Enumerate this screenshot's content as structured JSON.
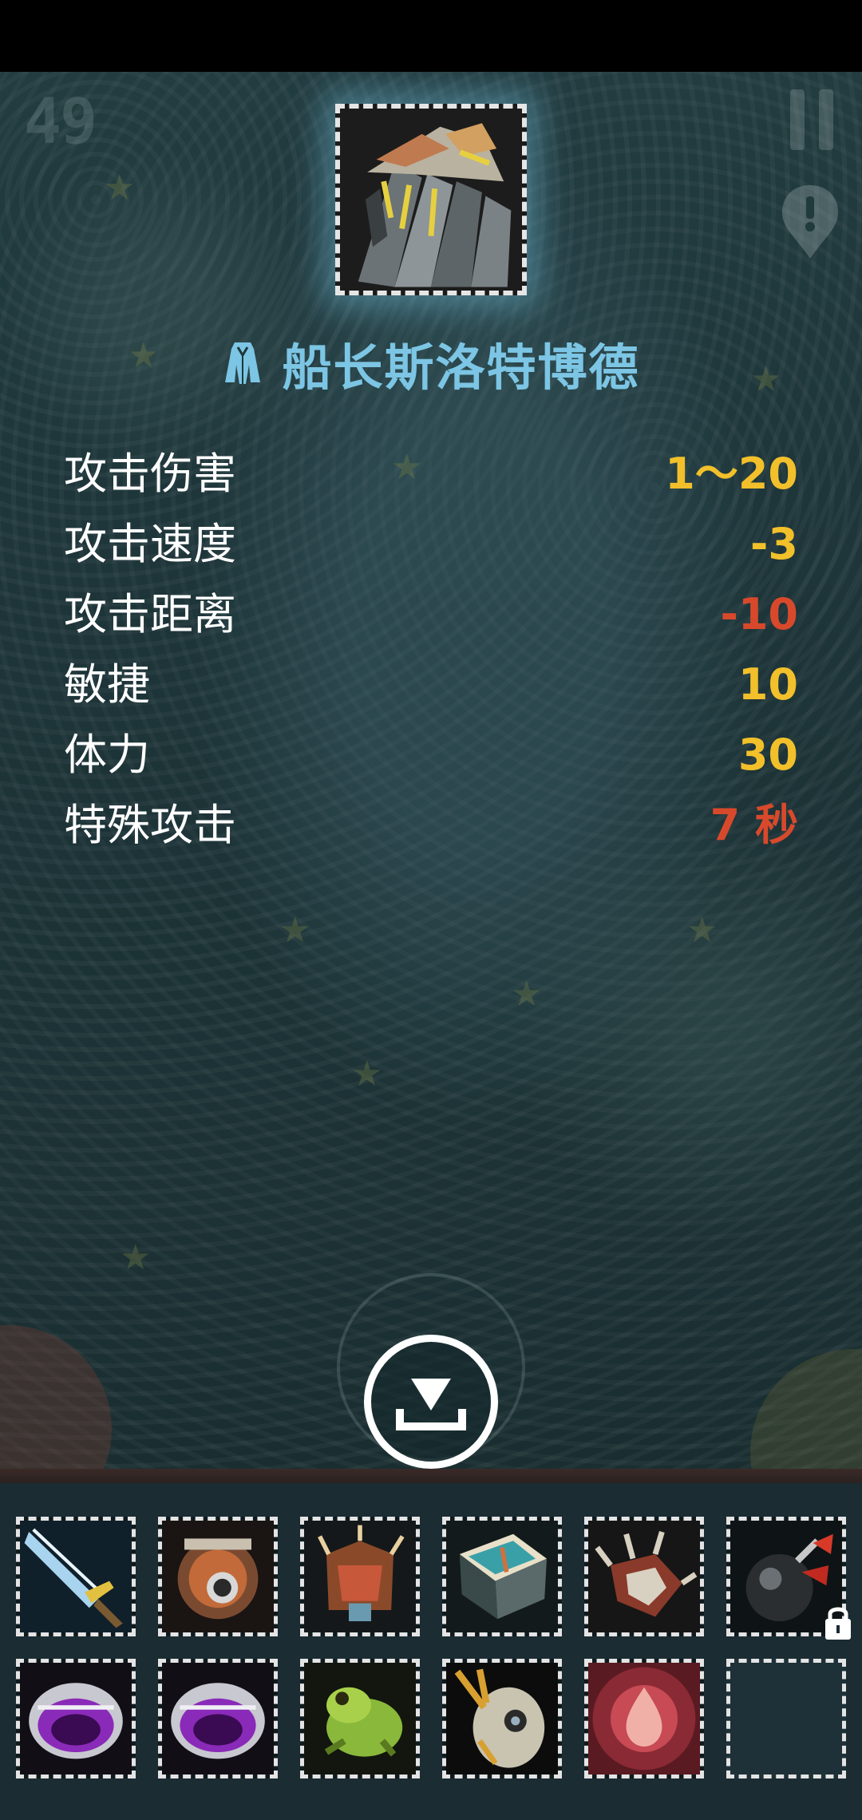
{
  "hud": {
    "level": "49"
  },
  "item": {
    "name": "船长斯洛特博德",
    "type_icon": "robe-icon",
    "stats": [
      {
        "label": "攻击伤害",
        "value": "1～20",
        "color": "#f2c02a"
      },
      {
        "label": "攻击速度",
        "value": "-3",
        "color": "#f2c02a"
      },
      {
        "label": "攻击距离",
        "value": "-10",
        "color": "#d8492b"
      },
      {
        "label": "敏捷",
        "value": "10",
        "color": "#f2c02a"
      },
      {
        "label": "体力",
        "value": "30",
        "color": "#f2c02a"
      },
      {
        "label": "特殊攻击",
        "value": "7 秒",
        "color": "#d8492b"
      }
    ]
  },
  "colors": {
    "title": "#7cc5e4",
    "positive": "#f2c02a",
    "negative": "#d8492b",
    "inventory_bg": "#1b2c33"
  },
  "inventory": {
    "row1": [
      "sword-item-icon",
      "shield-gear-item-icon",
      "spiked-armor-item-icon",
      "teal-chest-item-icon",
      "spiked-claw-item-icon",
      "bomb-item-icon"
    ],
    "row2": [
      "purple-ring-item-icon",
      "purple-ring-item-icon",
      "frog-item-icon",
      "skull-mask-item-icon",
      "red-potion-item-icon",
      "empty-slot"
    ],
    "locked_slot": "bomb-item-icon"
  }
}
